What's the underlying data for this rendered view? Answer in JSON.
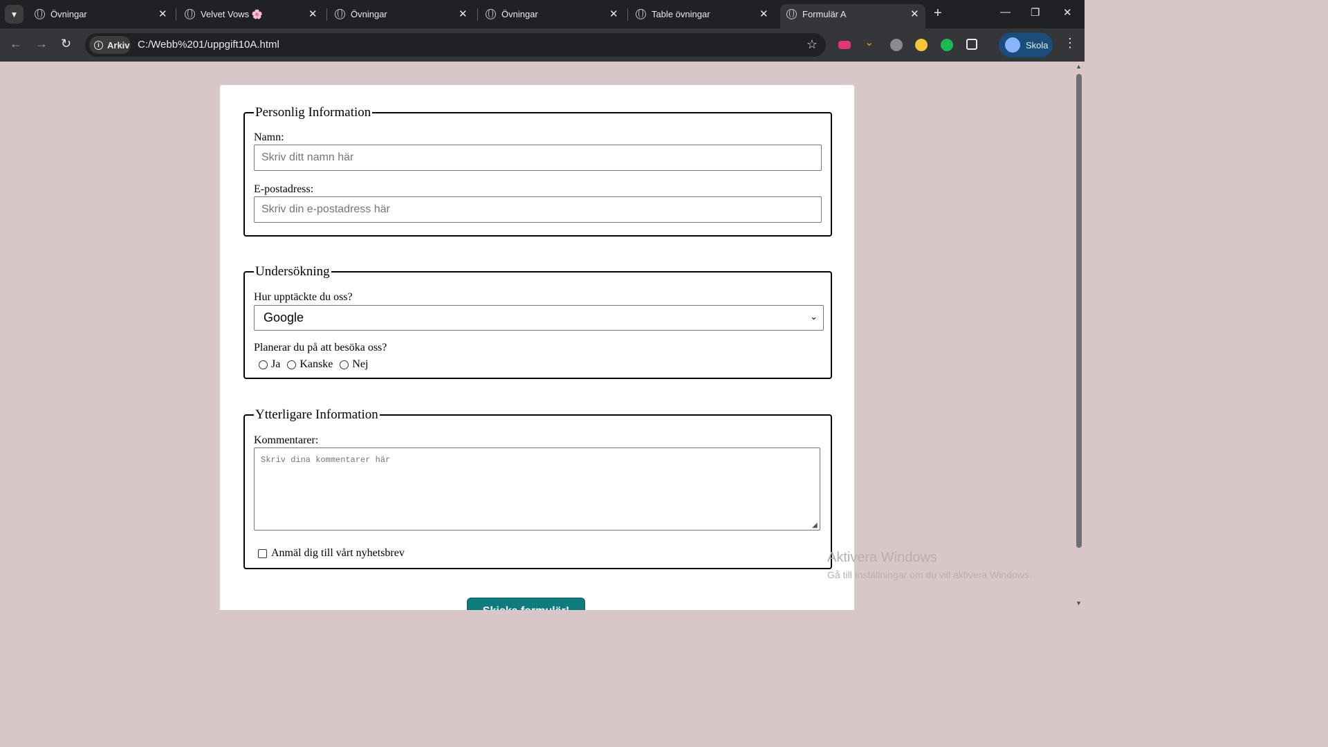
{
  "browser": {
    "tabs": [
      {
        "title": "Övningar"
      },
      {
        "title": "Velvet Vows 🌸"
      },
      {
        "title": "Övningar"
      },
      {
        "title": "Övningar"
      },
      {
        "title": "Table övningar"
      },
      {
        "title": "Formulär A"
      }
    ],
    "close_glyph": "✕",
    "new_tab_glyph": "+",
    "address": {
      "chip_label": "Arkiv",
      "url": "C:/Webb%201/uppgift10A.html"
    },
    "profile": {
      "label": "Skola"
    },
    "window_controls": {
      "minimize": "—",
      "restore": "❐",
      "close": "✕"
    },
    "icons": {
      "tab_search": "chevron-down-icon",
      "back": "back-arrow-icon",
      "forward": "forward-arrow-icon",
      "reload": "reload-icon",
      "bookmark": "star-icon",
      "extensions": "puzzle-icon",
      "menu": "more-vert-icon"
    },
    "colors": {
      "tabstrip": "#202124",
      "toolbar": "#35363a",
      "profile": "#1b4d7a"
    }
  },
  "page": {
    "background": "#d9c6c8",
    "personal": {
      "legend": "Personlig Information",
      "name_label": "Namn:",
      "name_placeholder": "Skriv ditt namn här",
      "email_label": "E-postadress:",
      "email_placeholder": "Skriv din e-postadress här"
    },
    "survey": {
      "legend": "Undersökning",
      "source_label": "Hur upptäckte du oss?",
      "source_selected": "Google",
      "visit_label": "Planerar du på att besöka oss?",
      "visit_options": [
        "Ja",
        "Kanske",
        "Nej"
      ]
    },
    "extra": {
      "legend": "Ytterligare Information",
      "comments_label": "Kommentarer:",
      "comments_placeholder": "Skriv dina kommentarer här",
      "newsletter_label": "Anmäl dig till vårt nyhetsbrev"
    },
    "submit": {
      "label": "Skicka formulär!",
      "color": "#0f7b7e"
    }
  },
  "watermark": {
    "title": "Aktivera Windows",
    "subtitle": "Gå till Inställningar om du vill aktivera Windows."
  }
}
